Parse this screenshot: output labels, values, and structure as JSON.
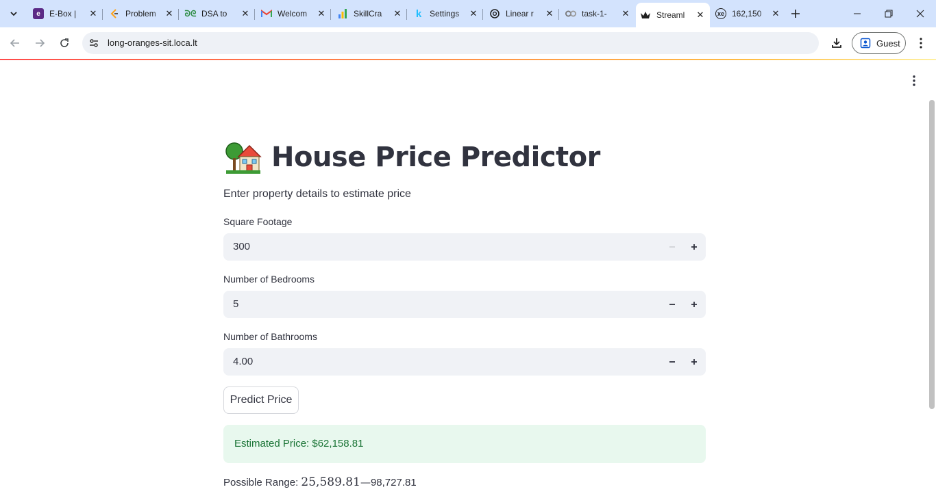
{
  "browser": {
    "tabs": [
      {
        "title": "E-Box |",
        "icon": "ebox-favicon"
      },
      {
        "title": "Problem",
        "icon": "problem-favicon"
      },
      {
        "title": "DSA to",
        "icon": "gfg-favicon"
      },
      {
        "title": "Welcom",
        "icon": "gmail-favicon"
      },
      {
        "title": "SkillCra",
        "icon": "skillcraft-favicon"
      },
      {
        "title": "Settings",
        "icon": "kaggle-favicon"
      },
      {
        "title": "Linear r",
        "icon": "openai-favicon"
      },
      {
        "title": "task-1-",
        "icon": "colab-favicon"
      },
      {
        "title": "Streaml",
        "icon": "streamlit-favicon",
        "active": true
      },
      {
        "title": "162,150",
        "icon": "xe-favicon"
      }
    ],
    "url": "long-oranges-sit.loca.lt",
    "profile_label": "Guest"
  },
  "app": {
    "title": "House Price Predictor",
    "title_emoji": "house-with-garden-icon",
    "subtitle": "Enter property details to estimate price",
    "fields": {
      "sqft": {
        "label": "Square Footage",
        "value": "300"
      },
      "bedrooms": {
        "label": "Number of Bedrooms",
        "value": "5"
      },
      "bathrooms": {
        "label": "Number of Bathrooms",
        "value": "4.00"
      }
    },
    "predict_button": "Predict Price",
    "result": "Estimated Price: $62,158.81",
    "range_prefix": "Possible Range: ",
    "range_low_math": "25,589.81",
    "range_dash": "—",
    "range_high": "98,727.81"
  },
  "colors": {
    "accent": "#ff4b4b",
    "success_bg": "#e8f8ee",
    "success_text": "#177233",
    "input_bg": "#f0f2f6",
    "text": "#31333f",
    "tabstrip_bg": "#d3e3fd"
  }
}
